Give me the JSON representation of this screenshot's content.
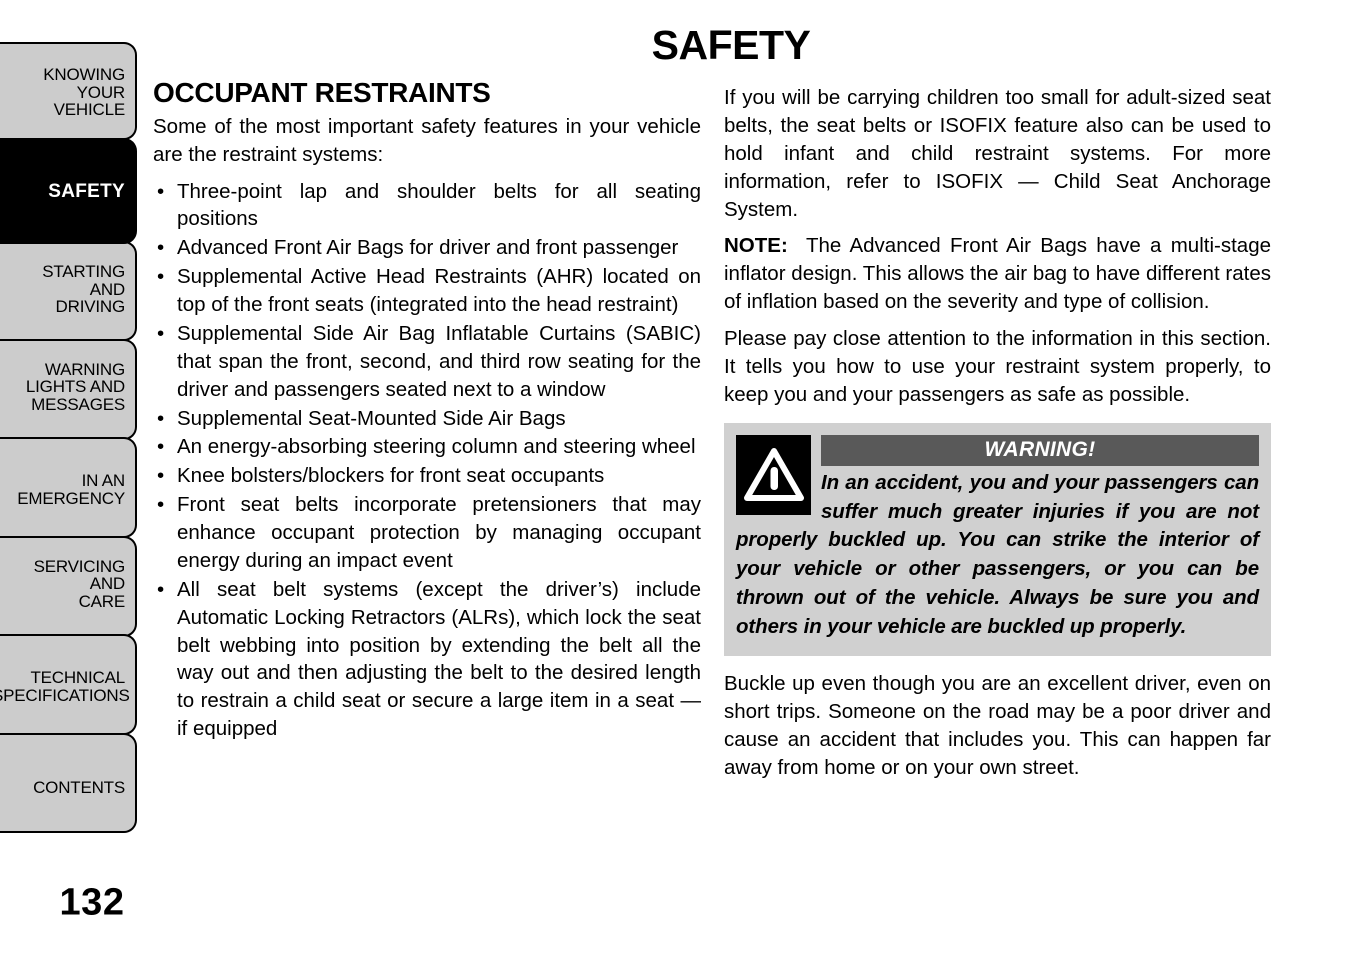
{
  "page": {
    "title": "SAFETY",
    "number": "132"
  },
  "sidebar": {
    "tabs": [
      {
        "id": "knowing-your-vehicle",
        "lines": [
          "KNOWING",
          "YOUR",
          "VEHICLE"
        ],
        "active": false
      },
      {
        "id": "safety",
        "lines": [
          "SAFETY"
        ],
        "active": true
      },
      {
        "id": "starting-and-driving",
        "lines": [
          "STARTING",
          "AND",
          "DRIVING"
        ],
        "active": false
      },
      {
        "id": "warning-lights-and-messages",
        "lines": [
          "WARNING",
          "LIGHTS AND",
          "MESSAGES"
        ],
        "active": false
      },
      {
        "id": "in-an-emergency",
        "lines": [
          "IN AN",
          "EMERGENCY"
        ],
        "active": false
      },
      {
        "id": "servicing-and-care",
        "lines": [
          "SERVICING",
          "AND",
          "CARE"
        ],
        "active": false
      },
      {
        "id": "technical-specifications",
        "lines": [
          "TECHNICAL",
          "SPECIFICATIONS"
        ],
        "active": false
      },
      {
        "id": "contents",
        "lines": [
          "CONTENTS"
        ],
        "active": false
      }
    ]
  },
  "left_column": {
    "heading": "OCCUPANT RESTRAINTS",
    "intro": "Some of the most important safety features in your vehicle are the restraint systems:",
    "bullets": [
      "Three-point lap and shoulder belts for all seating positions",
      "Advanced Front Air Bags for driver and front passenger",
      "Supplemental Active Head Restraints (AHR) located on top of the front seats (integrated into the head restraint)",
      "Supplemental Side Air Bag Inflatable Curtains (SABIC) that span the front, second, and third row seating for the driver and passengers seated next to a window",
      "Supplemental Seat-Mounted Side Air Bags",
      "An energy-absorbing steering column and steering wheel",
      "Knee bolsters/blockers for front seat occupants",
      "Front seat belts incorporate pretensioners that may enhance occupant protection by managing occupant energy during an impact event",
      "All seat belt systems (except the driver’s) include Automatic Locking Retractors (ALRs), which lock the seat belt webbing into position by extending the belt all the way out and then adjusting the belt to the desired length to restrain a child seat or secure a large item in a seat — if equipped"
    ]
  },
  "right_column": {
    "paragraph_1": "If you will be carrying children too small for adult-sized seat belts, the seat belts or ISOFIX feature also can be used to hold infant and child restraint systems. For more information, refer to ISOFIX — Child Seat Anchorage System.",
    "note_label": "NOTE:",
    "note_text": "The Advanced Front Air Bags have a multi-stage inflator design. This allows the air bag to have different rates of inflation based on the severity and type of collision.",
    "paragraph_2": "Please pay close attention to the information in this section. It tells you how to use your restraint system properly, to keep you and your passengers as safe as possible.",
    "warning": {
      "icon": "warning-triangle-icon",
      "banner": "WARNING!",
      "text": "In an accident, you and your passengers can suffer much greater injuries if you are not properly buckled up. You can strike the interior of your vehicle or other passengers, or you can be thrown out of the vehicle. Always be sure you and others in your vehicle are buckled up properly."
    },
    "paragraph_3": "Buckle up even though you are an excellent driver, even on short trips. Someone on the road may be a poor driver and cause an accident that includes you. This can happen far away from home or on your own street."
  },
  "colors": {
    "tab_inactive_bg": "#cccccc",
    "tab_active_bg": "#000000",
    "warning_box_bg": "#d0d0d0",
    "warning_banner_bg": "#595959",
    "page_bg": "#ffffff",
    "text": "#000000"
  }
}
